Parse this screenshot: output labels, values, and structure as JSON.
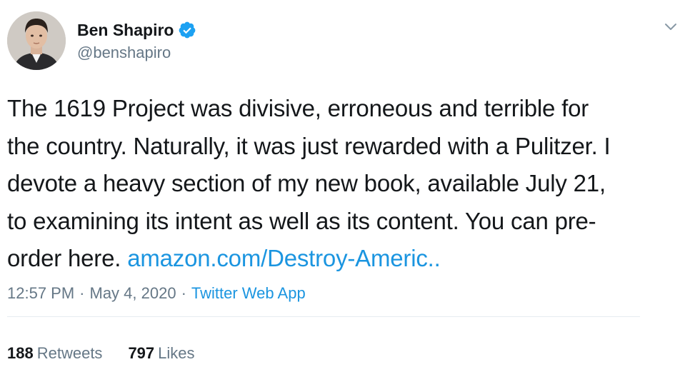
{
  "author": {
    "display_name": "Ben Shapiro",
    "handle": "@benshapiro",
    "verified": true
  },
  "tweet": {
    "lines": [
      "The 1619 Project was divisive, erroneous and terrible for",
      "the country. Naturally, it was just rewarded with a Pulitzer. I",
      "devote a heavy section of my new book, available July 21,",
      "to examining its intent as well as its content. You can pre-"
    ],
    "last_line_text": "order here.",
    "link_text": "amazon.com/Destroy-Americ.."
  },
  "meta": {
    "time": "12:57 PM",
    "separator": "·",
    "date": "May 4, 2020",
    "source": "Twitter Web App"
  },
  "stats": {
    "retweets_count": "188",
    "retweets_label": "Retweets",
    "likes_count": "797",
    "likes_label": "Likes"
  },
  "colors": {
    "link": "#1b95e0",
    "text": "#14171a",
    "muted": "#657786",
    "divider": "#e6ecf0"
  },
  "icons": {
    "verified": "verified-badge-icon",
    "menu": "chevron-down-icon"
  }
}
